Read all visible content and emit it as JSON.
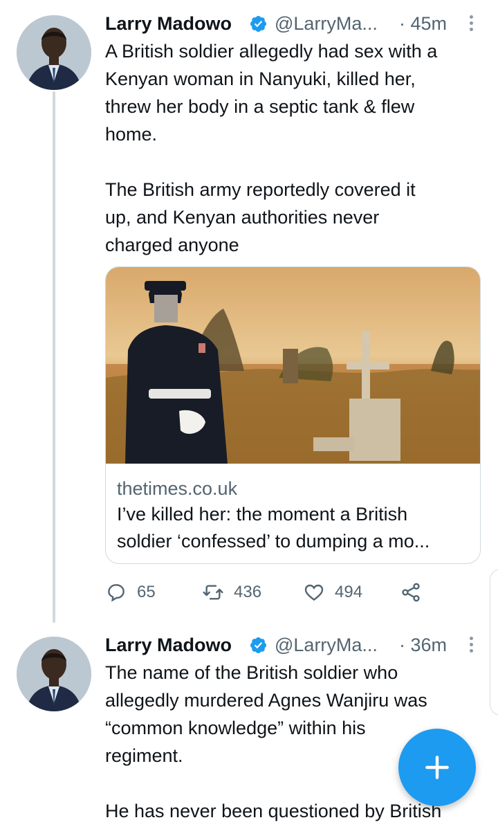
{
  "tweets": [
    {
      "author_name": "Larry Madowo",
      "author_handle": "@LarryMa...",
      "time": "· 45m",
      "text_paragraphs": [
        "A British soldier allegedly had sex with a\nKenyan woman in Nanyuki, killed her,\nthrew her body in a septic tank & flew\nhome.",
        "The British army reportedly covered it\nup, and Kenyan authorities never\ncharged anyone"
      ],
      "link_card": {
        "domain": "thetimes.co.uk",
        "title": "I’ve killed her: the moment a British\nsoldier ‘confessed’ to dumping a mo..."
      },
      "stats": {
        "replies": "65",
        "retweets": "436",
        "likes": "494"
      }
    },
    {
      "author_name": "Larry Madowo",
      "author_handle": "@LarryMa...",
      "time": "· 36m",
      "text_paragraphs": [
        "The name of the British soldier who\nallegedly murdered Agnes Wanjiru was\n“common knowledge” within his\nregiment.",
        "He has never been questioned by British"
      ]
    }
  ],
  "icons": {
    "verified": "verified-badge-icon",
    "reply": "reply-bubble-icon",
    "retweet": "retweet-icon",
    "like": "heart-icon",
    "share": "share-icon",
    "compose": "plus-icon",
    "more": "more-vertical-icon"
  },
  "colors": {
    "accent": "#1d9bf0",
    "secondary_text": "#536471",
    "thread_line": "#cfd9de"
  }
}
